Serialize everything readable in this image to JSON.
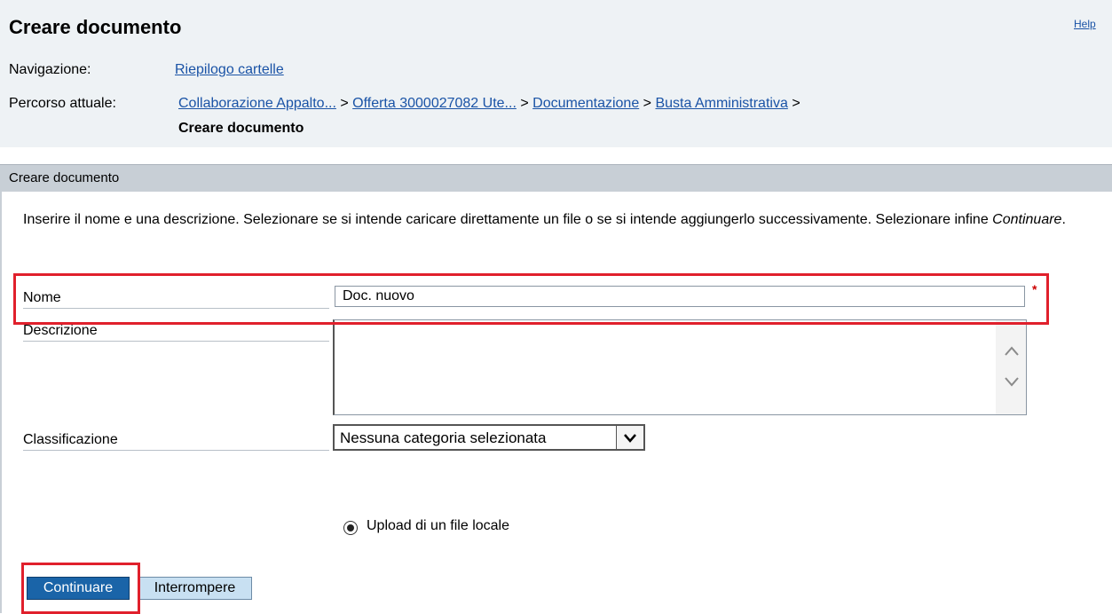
{
  "header": {
    "title": "Creare documento",
    "help_label": "Help",
    "navigation_label": "Navigazione:",
    "navigation_link": "Riepilogo cartelle",
    "path_label": "Percorso attuale:",
    "path": [
      {
        "label": "Collaborazione Appalto...",
        "separator": ">"
      },
      {
        "label": "Offerta 3000027082 Ute...",
        "separator": ">"
      },
      {
        "label": "Documentazione",
        "separator": ">"
      },
      {
        "label": "Busta Amministrativa",
        "separator": ">"
      }
    ],
    "current_page": "Creare documento"
  },
  "section": {
    "title": "Creare documento",
    "instructions_prefix": "Inserire il nome e una descrizione. Selezionare se si intende caricare direttamente un file o se si intende aggiungerlo successivamente. Selezionare infine ",
    "instructions_emphasis": "Continuare",
    "instructions_suffix": "."
  },
  "form": {
    "name_label": "Nome",
    "name_value": "Doc. nuovo",
    "required_marker": "*",
    "description_label": "Descrizione",
    "description_value": "",
    "classification_label": "Classificazione",
    "classification_value": "Nessuna categoria selezionata",
    "upload_option": "Upload di un file locale"
  },
  "buttons": {
    "continue_label": "Continuare",
    "cancel_label": "Interrompere"
  },
  "colors": {
    "highlight": "#e0202c",
    "link": "#1a53a6",
    "primary_button": "#1a64a8",
    "secondary_button": "#c8e0f2"
  },
  "icons": {
    "scroll_up": "chevron-up-icon",
    "scroll_down": "chevron-down-icon",
    "select_arrow": "chevron-down-icon",
    "radio": "radio-selected-icon"
  }
}
